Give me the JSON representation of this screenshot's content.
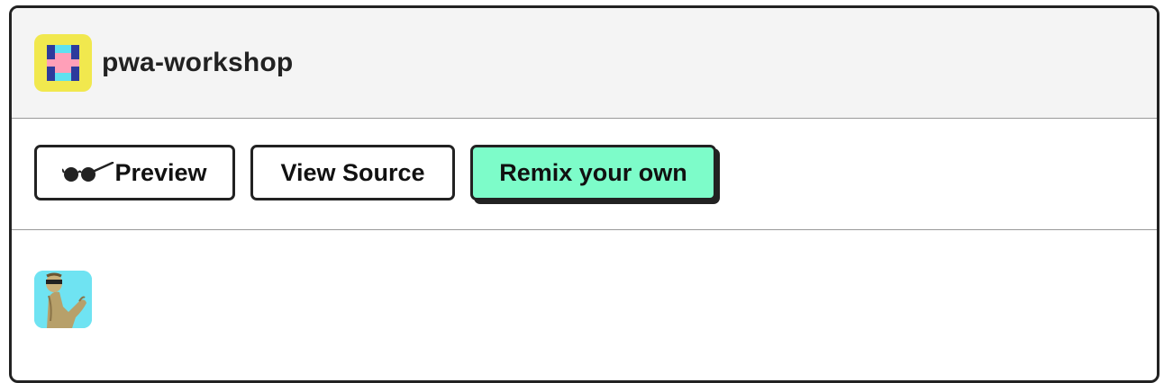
{
  "project": {
    "name": "pwa-workshop",
    "logo_icon": "glitch-project-logo-icon"
  },
  "actions": {
    "preview_label": "Preview",
    "preview_icon": "sunglasses-icon",
    "view_source_label": "View Source",
    "remix_label": "Remix your own"
  },
  "colors": {
    "remix_accent": "#7dfcc9",
    "logo_background": "#f1e84e",
    "border": "#222222",
    "header_background": "#f4f4f4"
  },
  "user": {
    "avatar_icon": "user-avatar-illustration"
  }
}
